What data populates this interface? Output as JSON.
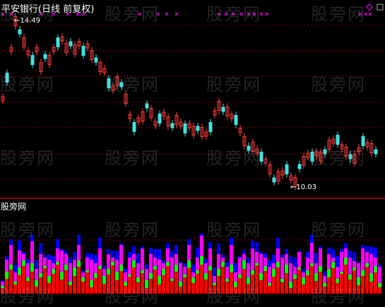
{
  "title": "平安银行(日线 前复权)",
  "high_label": "14.49",
  "low_label": "10.03",
  "lower_panel_label": "股旁网",
  "watermark": "股旁网",
  "colors": {
    "up": "#ff3b3b",
    "down": "#40e0e0",
    "grid": "#8b0000",
    "divider": "#ff0000",
    "signal": "#ff00ff",
    "vol_red": "#ff0000",
    "vol_green": "#00ff00",
    "vol_magenta": "#ff00ff",
    "vol_blue": "#0000ff"
  }
}
